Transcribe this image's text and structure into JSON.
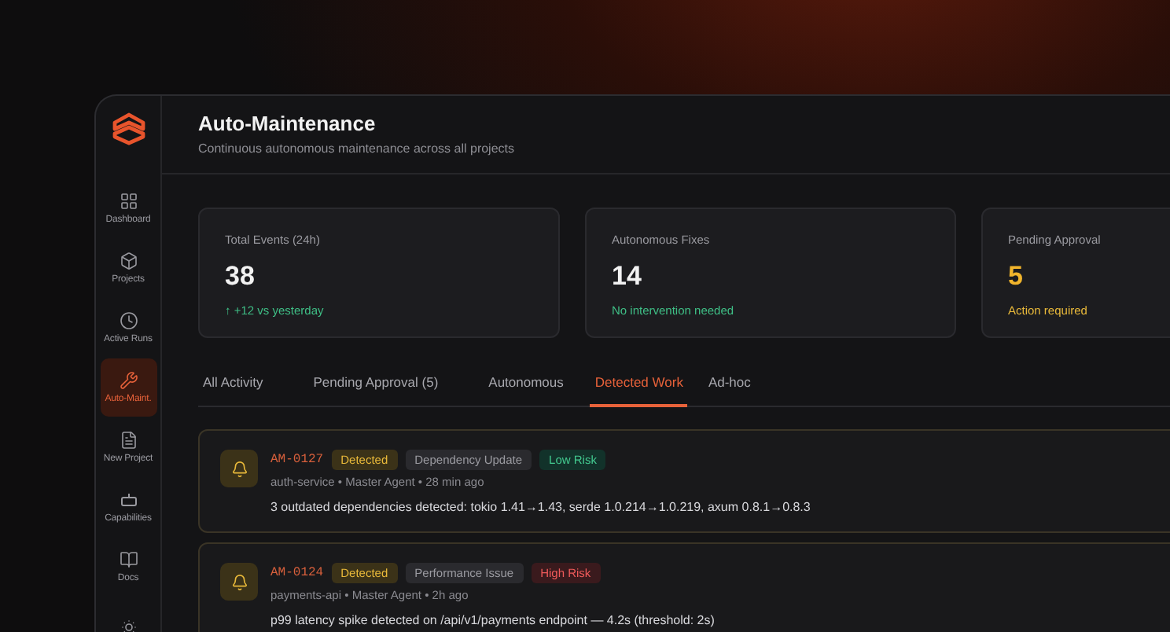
{
  "app": {
    "title": "Auto-Maintenance",
    "subtitle": "Continuous autonomous maintenance across all projects"
  },
  "sidebar": {
    "items": [
      {
        "label": "Dashboard",
        "selected": false
      },
      {
        "label": "Projects",
        "selected": false
      },
      {
        "label": "Active Runs",
        "selected": false
      },
      {
        "label": "Auto-Maint.",
        "selected": true
      },
      {
        "label": "New Project",
        "selected": false
      },
      {
        "label": "Capabilities",
        "selected": false
      },
      {
        "label": "Docs",
        "selected": false
      },
      {
        "selected": false
      }
    ]
  },
  "stats": [
    {
      "label": "Total Events (24h)",
      "value": "38",
      "note": "↑ +12 vs yesterday",
      "kind": "ok"
    },
    {
      "label": "Autonomous Fixes",
      "value": "14",
      "note": "No intervention needed",
      "kind": "ok"
    },
    {
      "label": "Pending Approval",
      "value": "5",
      "note": "Action required",
      "kind": "warning"
    }
  ],
  "tabs": [
    {
      "label": "All Activity",
      "selected": false
    },
    {
      "label": "Pending Approval (5)",
      "selected": false
    },
    {
      "label": "Autonomous",
      "selected": false
    },
    {
      "label": "Detected Work",
      "selected": true
    },
    {
      "label": "Ad-hoc",
      "selected": false
    }
  ],
  "events": [
    {
      "id": "AM-0127",
      "status": "Detected",
      "category": "Dependency Update",
      "risk": {
        "label": "Low Risk",
        "kind": "low"
      },
      "meta": "auth-service • Master Agent • 28 min ago",
      "description": "3 outdated dependencies detected: tokio 1.41→1.43, serde 1.0.214→1.0.219, axum 0.8.1→0.8.3"
    },
    {
      "id": "AM-0124",
      "status": "Detected",
      "category": "Performance Issue",
      "risk": {
        "label": "High Risk",
        "kind": "high"
      },
      "meta": "payments-api • Master Agent • 2h ago",
      "description": "p99 latency spike detected on /api/v1/payments endpoint — 4.2s (threshold: 2s)"
    }
  ]
}
